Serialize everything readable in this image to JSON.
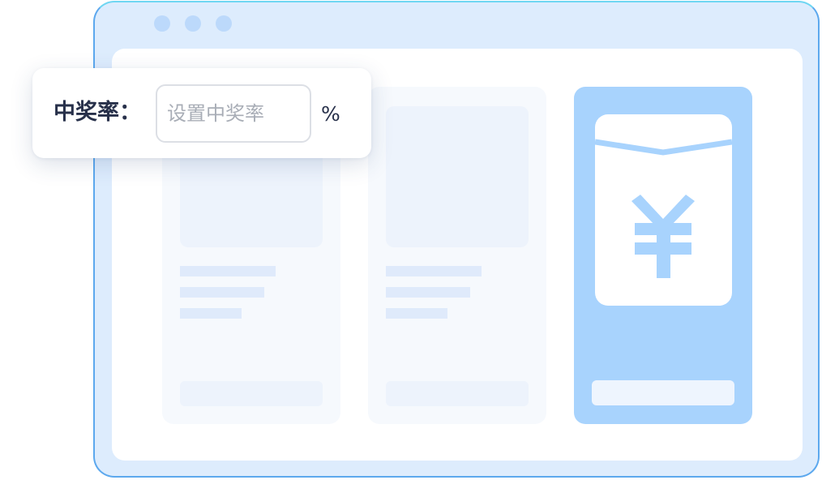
{
  "window": {
    "controls": [
      "window-dot",
      "window-dot",
      "window-dot"
    ]
  },
  "win_rate_popup": {
    "label": "中奖率：",
    "input": {
      "value": "",
      "placeholder": "设置中奖率"
    },
    "unit": "%"
  },
  "envelope_card": {
    "icon": "yen-icon",
    "currency_symbol": "¥"
  },
  "colors": {
    "window_border": "#5ca8ee",
    "window_bg": "#ddecfd",
    "highlight_card": "#a8d3fd",
    "label_text": "#27304a",
    "placeholder_text": "#a8adb6"
  }
}
